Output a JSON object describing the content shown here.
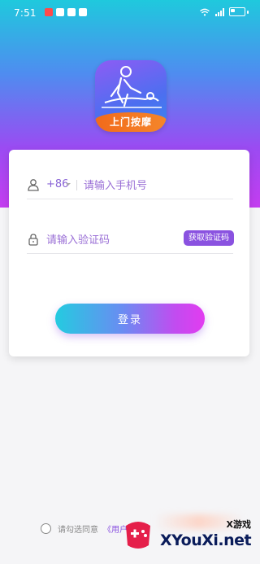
{
  "status_bar": {
    "time": "7:51",
    "battery_icon": "battery-icon",
    "wifi_icon": "wifi-icon",
    "signal_icon": "signal-icon"
  },
  "logo": {
    "banner_text": "上门按摩",
    "icon": "massage-therapist-icon"
  },
  "login_form": {
    "country_code": "+86",
    "phone_placeholder": "请输入手机号",
    "code_placeholder": "请输入验证码",
    "get_code_label": "获取验证码",
    "submit_label": "登录",
    "user_icon": "user-icon",
    "lock_icon": "lock-icon"
  },
  "agreement": {
    "text": "请勾选同意",
    "link": "《用户"
  },
  "watermark": {
    "small": "X游戏",
    "big": "XYouXi.net"
  },
  "colors": {
    "accent": "#8a52e0",
    "gradient_start": "#24cbe0",
    "gradient_end": "#e23cf0",
    "logo_banner": "#f26a1b"
  }
}
